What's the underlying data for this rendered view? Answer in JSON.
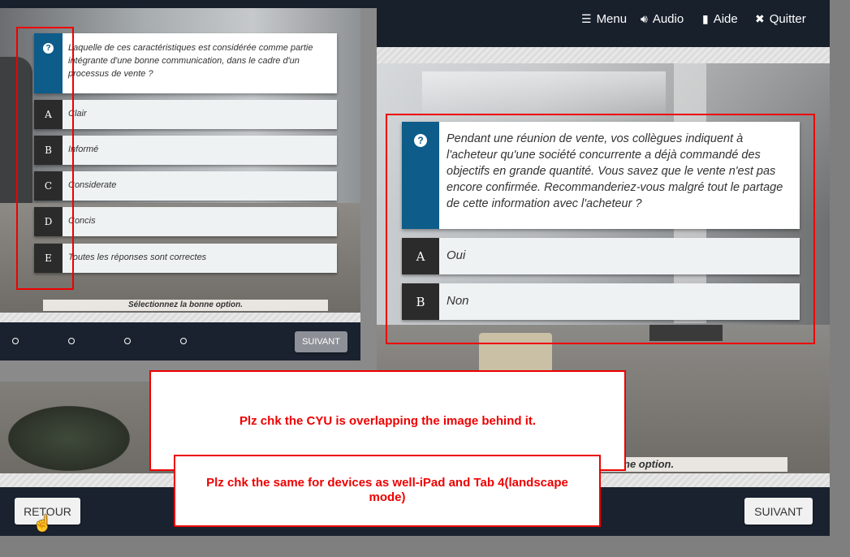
{
  "topnav": {
    "menu": "Menu",
    "audio": "Audio",
    "help": "Aide",
    "quit": "Quitter"
  },
  "main_question": {
    "text": "Pendant une réunion de vente, vos collègues indiquent à l'acheteur qu'une société concurrente a déjà commandé des objectifs en grande quantité. Vous savez que le vente n'est pas encore confirmée. Recommanderiez-vous malgré tout le partage de cette information avec l'acheteur ?",
    "options": [
      {
        "letter": "A",
        "label": "Oui"
      },
      {
        "letter": "B",
        "label": "Non"
      }
    ],
    "hint_partial": "ne option."
  },
  "bottom": {
    "back": "RETOUR",
    "next": "SUIVANT"
  },
  "overlay_question": {
    "text": "Laquelle de ces caractéristiques est considérée comme partie intégrante d'une bonne communication, dans le cadre d'un processus de vente ?",
    "options": [
      {
        "letter": "A",
        "label": "Clair"
      },
      {
        "letter": "B",
        "label": "Informé"
      },
      {
        "letter": "C",
        "label": "Considerate"
      },
      {
        "letter": "D",
        "label": "Concis"
      },
      {
        "letter": "E",
        "label": "Toutes les réponses sont correctes"
      }
    ],
    "hint": "Sélectionnez la bonne option.",
    "next": "SUIVANT"
  },
  "review_notes": {
    "note1": "Plz chk the CYU is overlapping the image behind it.",
    "note2": "Plz chk the same for devices as well-iPad and Tab 4(landscape mode)"
  },
  "colors": {
    "accent_blue": "#0d5c8a",
    "annotation_red": "#e00000",
    "dark_bar": "#1a2230"
  }
}
